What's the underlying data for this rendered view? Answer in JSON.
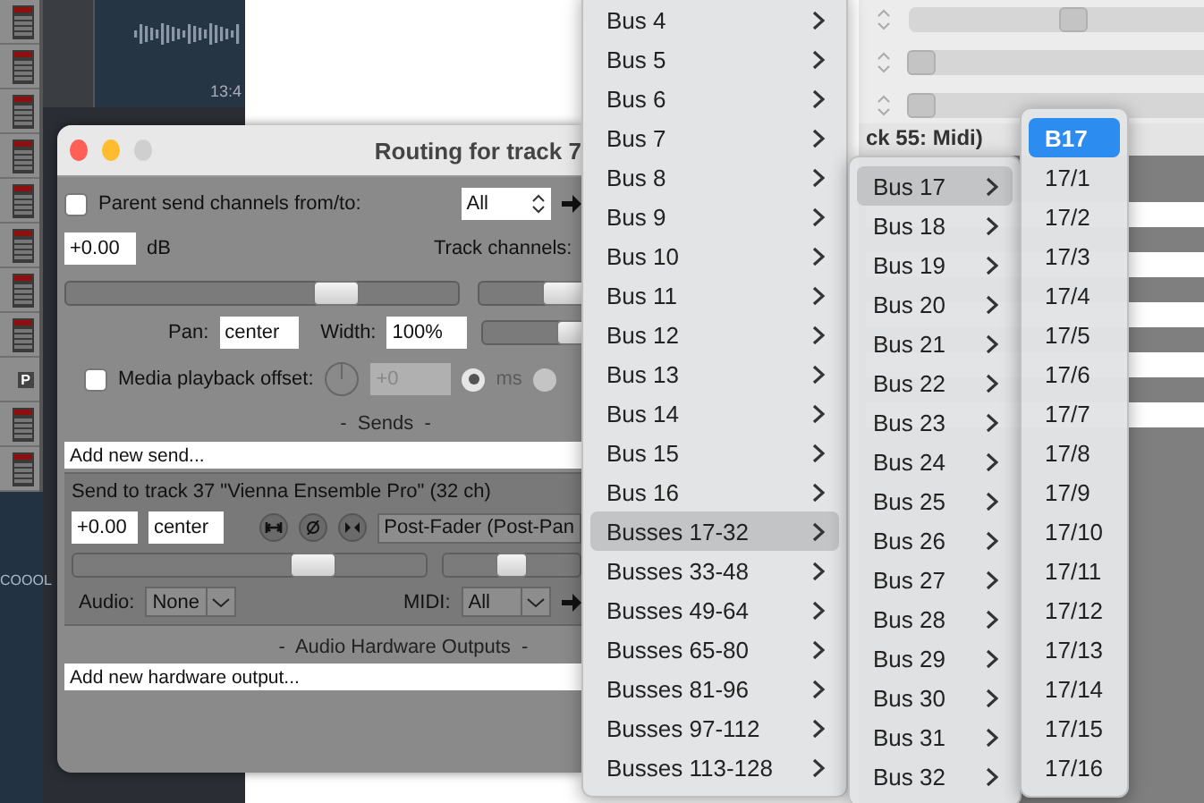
{
  "daw": {
    "track_meters": [
      {
        "kind": "meter"
      },
      {
        "kind": "meter"
      },
      {
        "kind": "meter"
      },
      {
        "kind": "meter"
      },
      {
        "kind": "meter"
      },
      {
        "kind": "meter"
      },
      {
        "kind": "meter"
      },
      {
        "kind": "meter"
      },
      {
        "kind": "badge",
        "badge": "P"
      },
      {
        "kind": "meter"
      },
      {
        "kind": "meter"
      }
    ],
    "timeline_label": "13:4",
    "track_label": "COOOL"
  },
  "background_window": {
    "title": "ck 55: Midi)",
    "sliders": [
      {
        "level": 0.56
      },
      {
        "level": 0.04
      },
      {
        "level": 0.04
      }
    ]
  },
  "routing_dialog": {
    "title": "Routing for track 7",
    "parent_send": {
      "checked": false,
      "label": "Parent send channels from/to:",
      "value": "All"
    },
    "volume": {
      "value": "+0.00",
      "unit": "dB",
      "level": 0.69
    },
    "track_channels_label": "Track channels:",
    "side_sliders": [
      {
        "level": 0.85
      },
      {
        "level": 1
      }
    ],
    "pan": {
      "label": "Pan:",
      "value": "center"
    },
    "width": {
      "label": "Width:",
      "value": "100%"
    },
    "media_offset": {
      "checked": false,
      "label": "Media playback offset:",
      "placeholder": "+0",
      "disabled": true,
      "units": [
        {
          "label": "ms",
          "selected": true
        },
        {
          "selected": false
        }
      ]
    },
    "sends_header": "-  Sends  -",
    "add_send": "Add new send...",
    "send": {
      "title": "Send to track 37 \"Vienna Ensemble Pro\" (32 ch)",
      "volume": "+0.00",
      "pan": "center",
      "mode": "Post-Fader (Post-Pan",
      "volume_slider": {
        "level": 0.68
      },
      "pan_slider": {
        "level": 0.5
      },
      "audio_label": "Audio:",
      "audio": "None",
      "midi_label": "MIDI:",
      "midi": "All"
    },
    "hw_header": "-  Audio Hardware Outputs  -",
    "add_hw": "Add new hardware output..."
  },
  "menus": [
    {
      "items": [
        {
          "label": "Bus 4",
          "submenu": true,
          "selected": false
        },
        {
          "label": "Bus 5",
          "submenu": true,
          "selected": false
        },
        {
          "label": "Bus 6",
          "submenu": true,
          "selected": false
        },
        {
          "label": "Bus 7",
          "submenu": true,
          "selected": false
        },
        {
          "label": "Bus 8",
          "submenu": true,
          "selected": false
        },
        {
          "label": "Bus 9",
          "submenu": true,
          "selected": false
        },
        {
          "label": "Bus 10",
          "submenu": true,
          "selected": false
        },
        {
          "label": "Bus 11",
          "submenu": true,
          "selected": false
        },
        {
          "label": "Bus 12",
          "submenu": true,
          "selected": false
        },
        {
          "label": "Bus 13",
          "submenu": true,
          "selected": false
        },
        {
          "label": "Bus 14",
          "submenu": true,
          "selected": false
        },
        {
          "label": "Bus 15",
          "submenu": true,
          "selected": false
        },
        {
          "label": "Bus 16",
          "submenu": true,
          "selected": false
        },
        {
          "label": "Busses 17-32",
          "submenu": true,
          "selected": true
        },
        {
          "label": "Busses 33-48",
          "submenu": true,
          "selected": false
        },
        {
          "label": "Busses 49-64",
          "submenu": true,
          "selected": false
        },
        {
          "label": "Busses 65-80",
          "submenu": true,
          "selected": false
        },
        {
          "label": "Busses 81-96",
          "submenu": true,
          "selected": false
        },
        {
          "label": "Busses 97-112",
          "submenu": true,
          "selected": false
        },
        {
          "label": "Busses 113-128",
          "submenu": true,
          "selected": false
        }
      ]
    },
    {
      "items": [
        {
          "label": "Bus 17",
          "submenu": true,
          "selected": true
        },
        {
          "label": "Bus 18",
          "submenu": true,
          "selected": false
        },
        {
          "label": "Bus 19",
          "submenu": true,
          "selected": false
        },
        {
          "label": "Bus 20",
          "submenu": true,
          "selected": false
        },
        {
          "label": "Bus 21",
          "submenu": true,
          "selected": false
        },
        {
          "label": "Bus 22",
          "submenu": true,
          "selected": false
        },
        {
          "label": "Bus 23",
          "submenu": true,
          "selected": false
        },
        {
          "label": "Bus 24",
          "submenu": true,
          "selected": false
        },
        {
          "label": "Bus 25",
          "submenu": true,
          "selected": false
        },
        {
          "label": "Bus 26",
          "submenu": true,
          "selected": false
        },
        {
          "label": "Bus 27",
          "submenu": true,
          "selected": false
        },
        {
          "label": "Bus 28",
          "submenu": true,
          "selected": false
        },
        {
          "label": "Bus 29",
          "submenu": true,
          "selected": false
        },
        {
          "label": "Bus 30",
          "submenu": true,
          "selected": false
        },
        {
          "label": "Bus 31",
          "submenu": true,
          "selected": false
        },
        {
          "label": "Bus 32",
          "submenu": true,
          "selected": false
        }
      ]
    },
    {
      "items": [
        {
          "label": "B17",
          "submenu": false,
          "selected": true
        },
        {
          "label": "17/1",
          "submenu": false,
          "selected": false
        },
        {
          "label": "17/2",
          "submenu": false,
          "selected": false
        },
        {
          "label": "17/3",
          "submenu": false,
          "selected": false
        },
        {
          "label": "17/4",
          "submenu": false,
          "selected": false
        },
        {
          "label": "17/5",
          "submenu": false,
          "selected": false
        },
        {
          "label": "17/6",
          "submenu": false,
          "selected": false
        },
        {
          "label": "17/7",
          "submenu": false,
          "selected": false
        },
        {
          "label": "17/8",
          "submenu": false,
          "selected": false
        },
        {
          "label": "17/9",
          "submenu": false,
          "selected": false
        },
        {
          "label": "17/10",
          "submenu": false,
          "selected": false
        },
        {
          "label": "17/11",
          "submenu": false,
          "selected": false
        },
        {
          "label": "17/12",
          "submenu": false,
          "selected": false
        },
        {
          "label": "17/13",
          "submenu": false,
          "selected": false
        },
        {
          "label": "17/14",
          "submenu": false,
          "selected": false
        },
        {
          "label": "17/15",
          "submenu": false,
          "selected": false
        },
        {
          "label": "17/16",
          "submenu": false,
          "selected": false
        }
      ]
    }
  ]
}
